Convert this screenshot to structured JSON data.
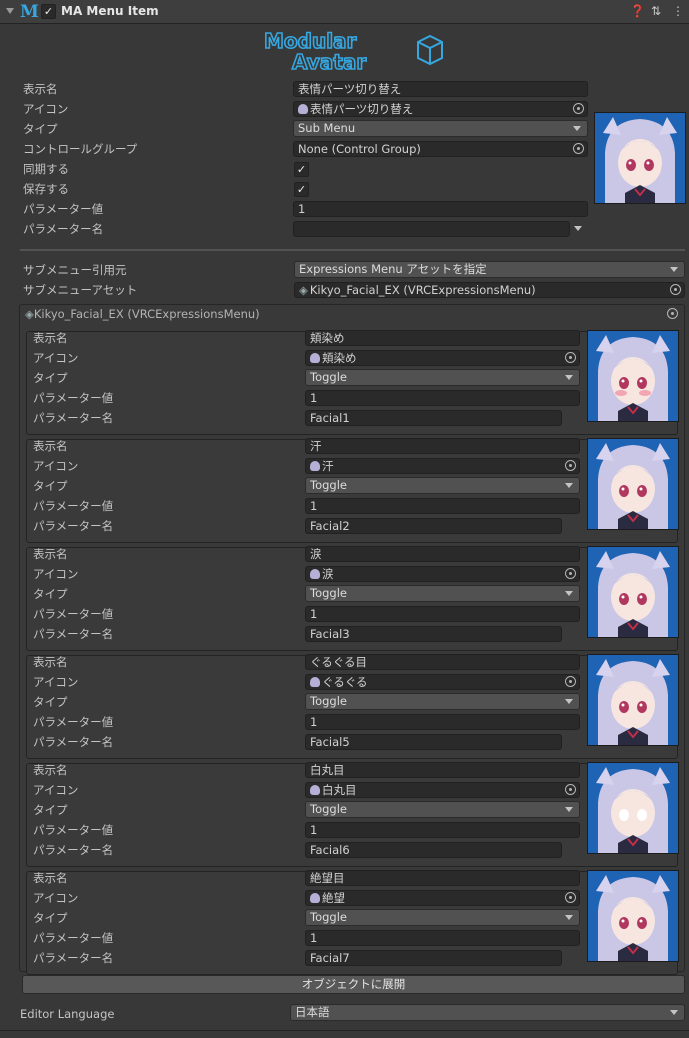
{
  "header": {
    "title": "MA Menu Item",
    "logo_letter": "M",
    "enabled": true,
    "icons": [
      "help-icon",
      "preset-icon",
      "more-icon"
    ]
  },
  "banner": {
    "line1": "Modular",
    "line2": "Avatar",
    "color": "#36a7e0"
  },
  "menu_item": {
    "display_name": {
      "label": "表示名",
      "value": "表情パーツ切り替え"
    },
    "icon": {
      "label": "アイコン",
      "value": "表情パーツ切り替え"
    },
    "type": {
      "label": "タイプ",
      "value": "Sub Menu"
    },
    "control_group": {
      "label": "コントロールグループ",
      "value": "None (Control Group)"
    },
    "synced": {
      "label": "同期する",
      "checked": true
    },
    "saved": {
      "label": "保存する",
      "checked": true
    },
    "param_value": {
      "label": "パラメーター値",
      "value": "1"
    },
    "param_name": {
      "label": "パラメーター名",
      "value": ""
    }
  },
  "submenu": {
    "source": {
      "label": "サブメニュー引用元",
      "value": "Expressions Menu アセットを指定"
    },
    "asset": {
      "label": "サブメニューアセット",
      "value": "Kikyo_Facial_EX (VRCExpressionsMenu)"
    },
    "panel_title": "Kikyo_Facial_EX (VRCExpressionsMenu)"
  },
  "item_labels": {
    "name": "表示名",
    "icon": "アイコン",
    "type": "タイプ",
    "value": "パラメーター値",
    "param": "パラメーター名"
  },
  "items": [
    {
      "name": "頬染め",
      "icon": "頬染め",
      "type": "Toggle",
      "value": "1",
      "param": "Facial1",
      "blush": true
    },
    {
      "name": "汗",
      "icon": "汗",
      "type": "Toggle",
      "value": "1",
      "param": "Facial2"
    },
    {
      "name": "涙",
      "icon": "涙",
      "type": "Toggle",
      "value": "1",
      "param": "Facial3"
    },
    {
      "name": "ぐるぐる目",
      "icon": "ぐるぐる",
      "type": "Toggle",
      "value": "1",
      "param": "Facial5"
    },
    {
      "name": "白丸目",
      "icon": "白丸目",
      "type": "Toggle",
      "value": "1",
      "param": "Facial6",
      "white_eyes": true
    },
    {
      "name": "絶望目",
      "icon": "絶望",
      "type": "Toggle",
      "value": "1",
      "param": "Facial7"
    }
  ],
  "expand_button": "オブジェクトに展開",
  "language": {
    "label": "Editor Language",
    "value": "日本語"
  },
  "colors": {
    "background": "#383838",
    "field": "#2a2a2a",
    "dropdown": "#515151",
    "accent": "#36a7e0",
    "avatar_bg": "#1f63b5"
  }
}
